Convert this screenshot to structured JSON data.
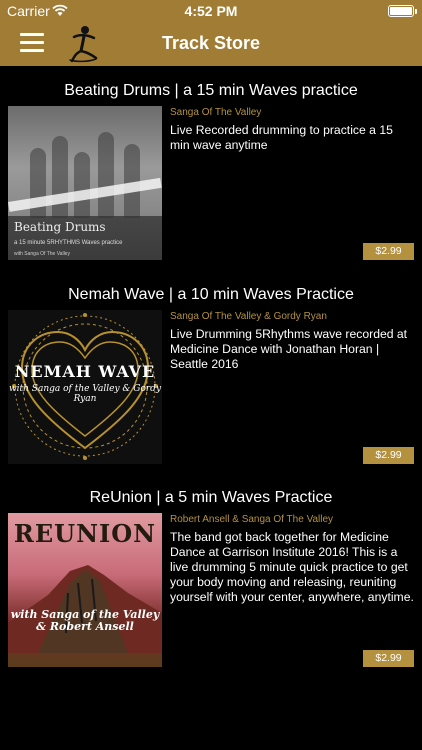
{
  "status_bar": {
    "carrier": "Carrier",
    "time": "4:52 PM"
  },
  "nav": {
    "title": "Track Store",
    "menu_icon": "hamburger-icon",
    "logo_icon": "dancer-logo-icon"
  },
  "colors": {
    "accent": "#a07c35",
    "price_bg": "#b3913f",
    "artist_text": "#b3913f"
  },
  "tracks": [
    {
      "title": "Beating Drums | a 15 min Waves practice",
      "artist": "Sanga Of The Valley",
      "description": "Live Recorded drumming to practice a 15 min wave anytime",
      "price": "$2.99",
      "cover": {
        "title": "Beating Drums",
        "subtitle": "a 15 minute 5RHYTHMS Waves practice",
        "byline": "with Sanga Of The Valley"
      }
    },
    {
      "title": "Nemah Wave | a 10 min Waves Practice",
      "artist": "Sanga Of The Valley & Gordy Ryan",
      "description": "Live Drumming 5Rhythms wave recorded at Medicine Dance with Jonathan Horan | Seattle 2016",
      "price": "$2.99",
      "cover": {
        "title": "NEMAH WAVE",
        "subtitle": "with Sanga of the Valley & Gordy Ryan"
      }
    },
    {
      "title": "ReUnion | a 5 min Waves Practice",
      "artist": "Robert Ansell & Sanga Of The Valley",
      "description": "The band got back together for Medicine Dance at Garrison Institute 2016!  This is a live drumming 5 minute quick practice to get your body moving and releasing, reuniting yourself with your center, anywhere, anytime.",
      "price": "$2.99",
      "cover": {
        "title": "REUNION",
        "subtitle": "with Sanga of the Valley & Robert Ansell"
      }
    }
  ]
}
